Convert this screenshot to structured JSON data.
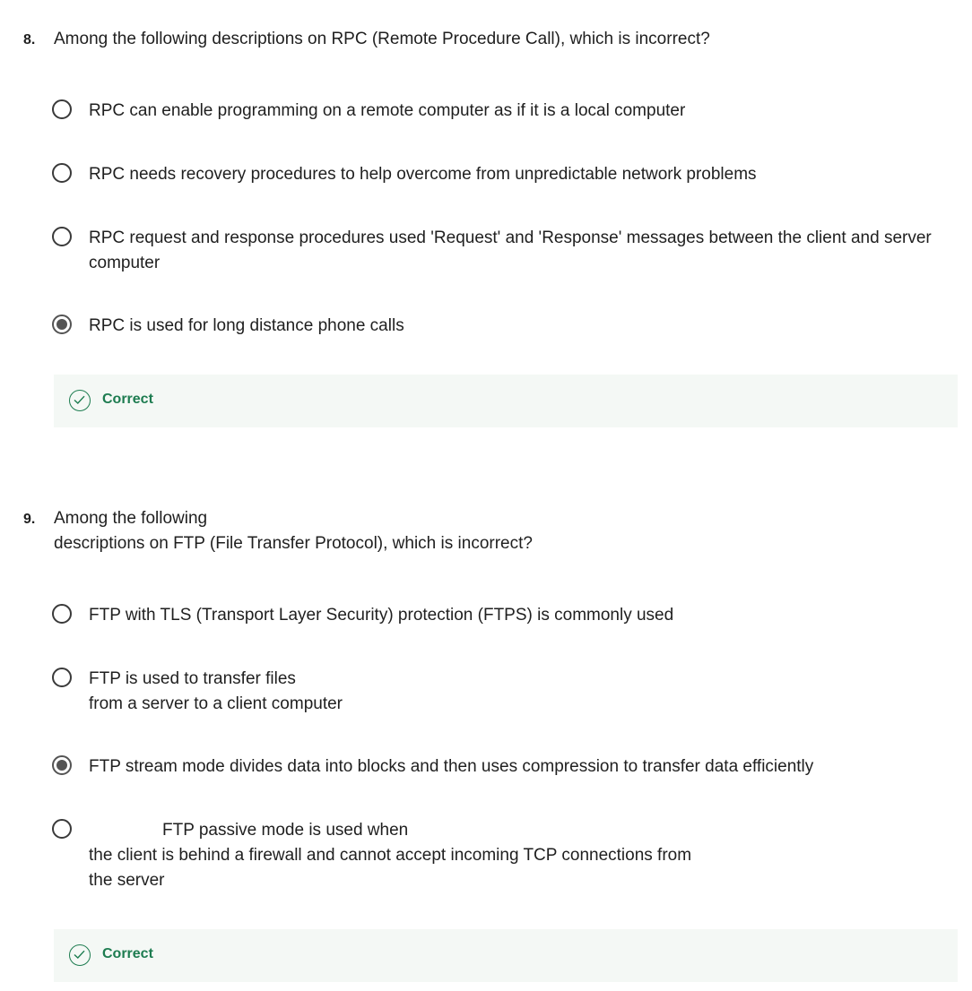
{
  "questions": [
    {
      "number": "8.",
      "text_lines": [
        "Among the following descriptions on RPC (Remote Procedure Call), which is incorrect?"
      ],
      "options": [
        {
          "lines": [
            "RPC can enable programming on a remote computer as if it is a local computer"
          ],
          "selected": false
        },
        {
          "lines": [
            "RPC needs recovery procedures to help overcome from unpredictable network problems"
          ],
          "selected": false
        },
        {
          "lines": [
            "RPC request and response procedures used 'Request' and 'Response' messages between the client and server",
            "computer"
          ],
          "selected": false
        },
        {
          "lines": [
            "RPC is used for long distance phone calls"
          ],
          "selected": true
        }
      ],
      "feedback": {
        "label": "Correct",
        "icon": "check-circle-icon",
        "color": "#1d7c50"
      }
    },
    {
      "number": "9.",
      "text_lines": [
        "Among the following",
        "descriptions on FTP (File Transfer Protocol), which is incorrect?"
      ],
      "options": [
        {
          "lines": [
            "FTP with TLS (Transport Layer Security) protection (FTPS) is commonly used"
          ],
          "selected": false
        },
        {
          "lines": [
            "FTP is used to transfer files",
            "from a server to a client computer"
          ],
          "selected": false
        },
        {
          "lines": [
            "FTP stream mode divides data into blocks and then uses compression to transfer data efficiently"
          ],
          "selected": true
        },
        {
          "lines": [
            "FTP passive mode is used when",
            "the client is behind a firewall and cannot accept incoming TCP connections from",
            "the server"
          ],
          "selected": false
        }
      ],
      "feedback": {
        "label": "Correct",
        "icon": "check-circle-icon",
        "color": "#1d7c50"
      }
    }
  ]
}
